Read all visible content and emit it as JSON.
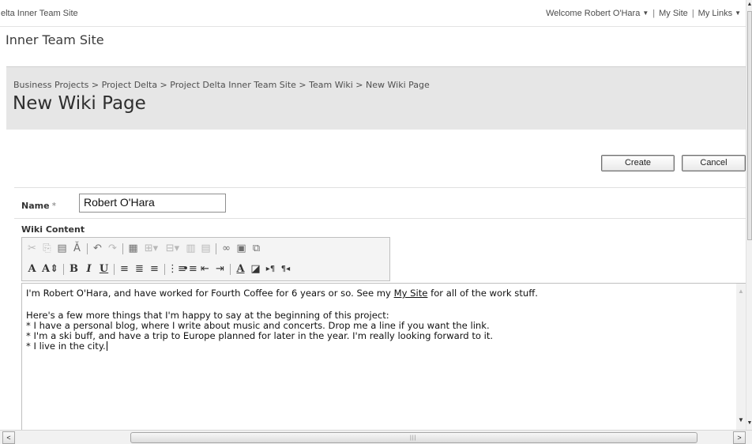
{
  "topbar": {
    "site_crumb": "elta Inner Team Site",
    "welcome": "Welcome Robert O'Hara",
    "my_site": "My Site",
    "my_links": "My Links",
    "separator": "|",
    "caret": "▼"
  },
  "site_title": "Inner Team Site",
  "breadcrumb": "Business Projects > Project Delta > Project Delta Inner Team Site > Team Wiki > New Wiki Page",
  "page_title": "New Wiki Page",
  "buttons": {
    "create": "Create",
    "cancel": "Cancel"
  },
  "form": {
    "name_label": "Name",
    "required_mark": "*",
    "name_value": "Robert O'Hara",
    "wiki_label": "Wiki Content"
  },
  "toolbar": {
    "row1": [
      {
        "name": "cut-icon",
        "glyph": "✂",
        "enabled": false
      },
      {
        "name": "copy-icon",
        "glyph": "⎘",
        "enabled": false
      },
      {
        "name": "paste-icon",
        "glyph": "📋",
        "enabled": true
      },
      {
        "name": "spellcheck-icon",
        "glyph": "ᴬᵇ",
        "enabled": true
      },
      {
        "name": "undo-icon",
        "glyph": "↶",
        "enabled": true
      },
      {
        "name": "redo-icon",
        "glyph": "↷",
        "enabled": false
      },
      {
        "name": "insert-table-icon",
        "glyph": "▦",
        "enabled": true
      },
      {
        "name": "insert-row-icon",
        "glyph": "⊞",
        "enabled": false
      },
      {
        "name": "insert-column-icon",
        "glyph": "⊟",
        "enabled": false
      },
      {
        "name": "merge-cells-icon",
        "glyph": "▥",
        "enabled": false
      },
      {
        "name": "split-cells-icon",
        "glyph": "▤",
        "enabled": false
      },
      {
        "name": "insert-link-icon",
        "glyph": "🔗",
        "enabled": true
      },
      {
        "name": "insert-image-icon",
        "glyph": "▣",
        "enabled": true
      },
      {
        "name": "edit-html-icon",
        "glyph": "⧉",
        "enabled": true
      }
    ],
    "row2": [
      {
        "name": "font-icon",
        "glyph": "A"
      },
      {
        "name": "font-size-icon",
        "glyph": "A⇕"
      },
      {
        "name": "bold-icon",
        "glyph": "B"
      },
      {
        "name": "italic-icon",
        "glyph": "I"
      },
      {
        "name": "underline-icon",
        "glyph": "U"
      },
      {
        "name": "align-left-icon",
        "glyph": "≡"
      },
      {
        "name": "align-center-icon",
        "glyph": "≣"
      },
      {
        "name": "align-right-icon",
        "glyph": "≡"
      },
      {
        "name": "numbered-list-icon",
        "glyph": "⋮≡"
      },
      {
        "name": "bulleted-list-icon",
        "glyph": "•≡"
      },
      {
        "name": "decrease-indent-icon",
        "glyph": "⇤"
      },
      {
        "name": "increase-indent-icon",
        "glyph": "⇥"
      },
      {
        "name": "text-color-icon",
        "glyph": "A"
      },
      {
        "name": "background-color-icon",
        "glyph": "◪"
      },
      {
        "name": "ltr-icon",
        "glyph": "▸¶"
      },
      {
        "name": "rtl-icon",
        "glyph": "¶◂"
      }
    ]
  },
  "content": {
    "line1_pre": "I'm Robert O'Hara, and have worked for Fourth Coffee for 6 years or so. See my ",
    "line1_link": "My Site",
    "line1_post": " for all of the work stuff.",
    "line2": "Here's a few more things that I'm happy to say at the beginning of this project:",
    "line3": "* I have a personal blog, where I write about music and concerts. Drop me a line if you want the link.",
    "line4": "* I'm a ski buff, and have a trip to Europe planned for later in the year. I'm really looking forward to it.",
    "line5": "* I live in the city."
  },
  "scroll": {
    "left": "<",
    "right": ">",
    "up": "▲",
    "down": "▼",
    "grip": "|||"
  },
  "colors": {
    "title_band": "#e6e6e6",
    "text": "#111111"
  }
}
